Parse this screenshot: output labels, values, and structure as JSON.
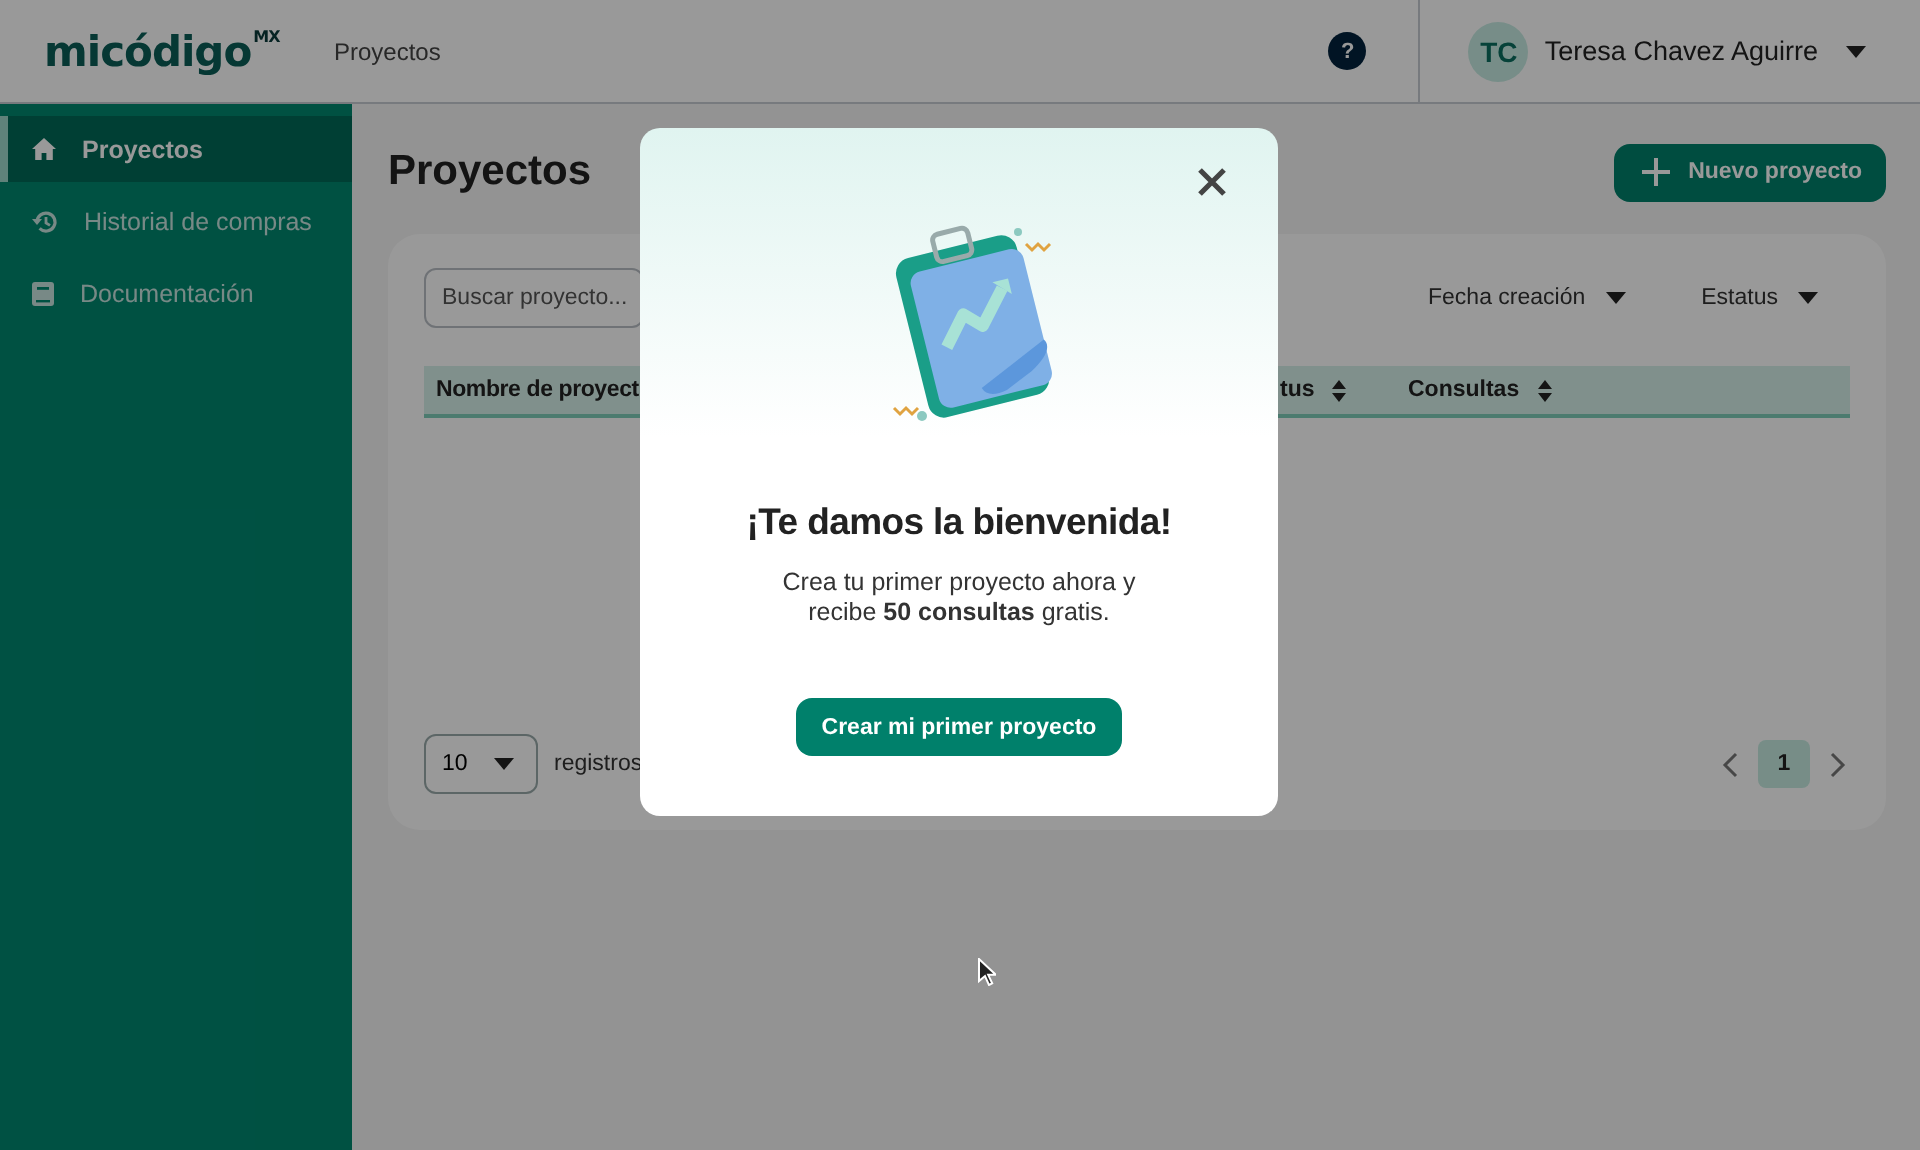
{
  "header": {
    "logo": {
      "name": "micódigo",
      "suffix": "MX"
    },
    "breadcrumb": "Proyectos",
    "help": "?",
    "user": {
      "initials": "TC",
      "name": "Teresa Chavez Aguirre"
    }
  },
  "sidebar": {
    "items": [
      {
        "label": "Proyectos",
        "kind": "home",
        "selected": true
      },
      {
        "label": "Historial de compras",
        "kind": "history",
        "selected": false
      },
      {
        "label": "Documentación",
        "kind": "book",
        "selected": false
      }
    ]
  },
  "main": {
    "title": "Proyectos",
    "new_button": "Nuevo proyecto",
    "search": {
      "placeholder": "Buscar proyecto..."
    },
    "filters": [
      "Fecha creación",
      "Estatus"
    ],
    "columns": [
      {
        "label": "Nombre de proyect"
      },
      {
        "label": "tus",
        "sortable": true
      },
      {
        "label": "Consultas",
        "sortable": true
      }
    ],
    "page_size": "10",
    "page_size_label": "registros",
    "pages": [
      {
        "label": "1",
        "selected": true
      }
    ]
  },
  "modal": {
    "title": "¡Te damos la bienvenida!",
    "message": "Crea tu primer proyecto ahora y recibe **50 consultas** gratis.",
    "button": "Crear mi primer proyecto"
  }
}
